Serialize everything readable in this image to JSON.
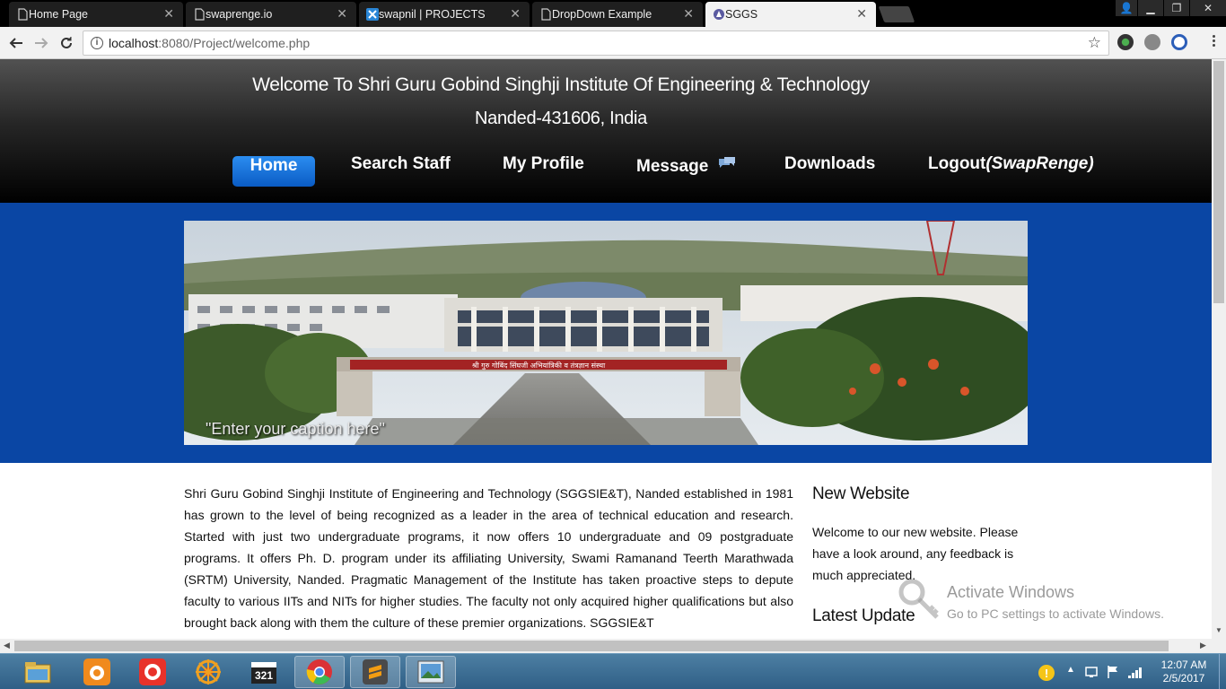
{
  "browser": {
    "tabs": [
      {
        "label": "Home Page",
        "active": false
      },
      {
        "label": "swaprenge.io",
        "active": false
      },
      {
        "label": "swapnil | PROJECTS",
        "active": false
      },
      {
        "label": "DropDown Example",
        "active": false
      },
      {
        "label": "SGGS",
        "active": true
      }
    ],
    "url_host": "localhost",
    "url_path": ":8080/Project/welcome.php",
    "accent": "#0a46a4"
  },
  "header": {
    "title": "Welcome To Shri Guru Gobind Singhji Institute Of Engineering & Technology",
    "subtitle": "Nanded-431606, India"
  },
  "nav": {
    "home": "Home",
    "search_staff": "Search Staff",
    "my_profile": "My Profile",
    "message": "Message",
    "downloads": "Downloads",
    "logout": "Logout",
    "username": "(SwapRenge)"
  },
  "banner": {
    "caption": "\"Enter your caption here\"",
    "sign_text": "श्री गुरु गोबिंद सिंघजी अभियांत्रिकी व तंत्रज्ञान संस्था"
  },
  "main": {
    "intro": "Shri Guru Gobind Singhji Institute of Engineering and Technology (SGGSIE&T), Nanded established in 1981 has grown to the level of being recognized as a leader in the area of technical education and research. Started with just two undergraduate programs, it now offers 10 undergraduate and 09 postgraduate programs. It offers Ph. D. program under its affiliating University, Swami Ramanand Teerth Marathwada (SRTM) University, Nanded. Pragmatic Management of the Institute has taken proactive steps to depute faculty to various IITs and NITs for higher studies. The faculty not only acquired higher qualifications but also brought back along with them the culture of these premier organizations. SGGSIE&T"
  },
  "sidebar": {
    "new_website_title": "New Website",
    "new_website_text": "Welcome to our new website. Please have a look around, any feedback is much appreciated.",
    "latest_update_title": "Latest Update"
  },
  "watermark": {
    "title": "Activate Windows",
    "subtitle": "Go to PC settings to activate Windows."
  },
  "taskbar": {
    "time": "12:07 AM",
    "date": "2/5/2017"
  }
}
